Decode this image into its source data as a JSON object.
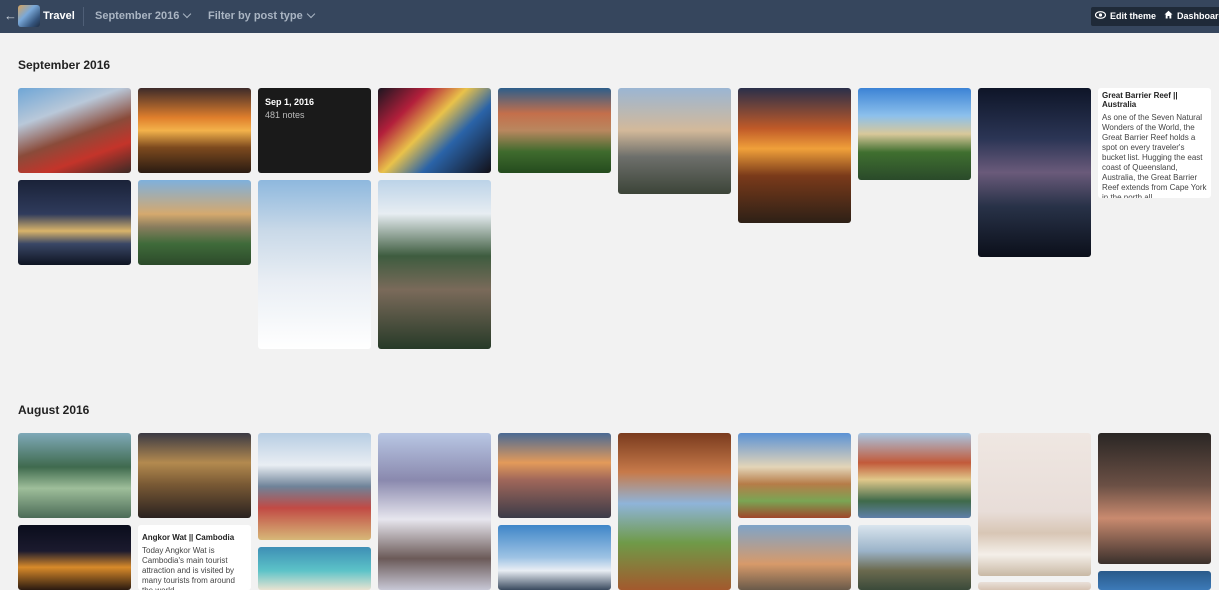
{
  "header": {
    "blog_title": "Travel",
    "month_select": "September 2016",
    "type_filter": "Filter by post type",
    "edit_theme": "Edit theme",
    "dashboard": "Dashboard"
  },
  "sections": {
    "september": {
      "heading": "September 2016",
      "overlay_date": "Sep 1, 2016",
      "overlay_notes": "481 notes",
      "text_post": {
        "title": "Great Barrier Reef || Australia",
        "body": "As one of the Seven Natural Wonders of the World, the Great Barrier Reef holds a spot on every traveler's bucket list. Hugging the east coast of Queensland, Australia, the Great Barrier Reef extends from Cape York in the north all"
      }
    },
    "august": {
      "heading": "August 2016",
      "text_post": {
        "title": "Angkor Wat || Cambodia",
        "body": "Today Angkor Wat is Cambodia's main tourist attraction and is visited by many tourists from around the world."
      }
    }
  }
}
